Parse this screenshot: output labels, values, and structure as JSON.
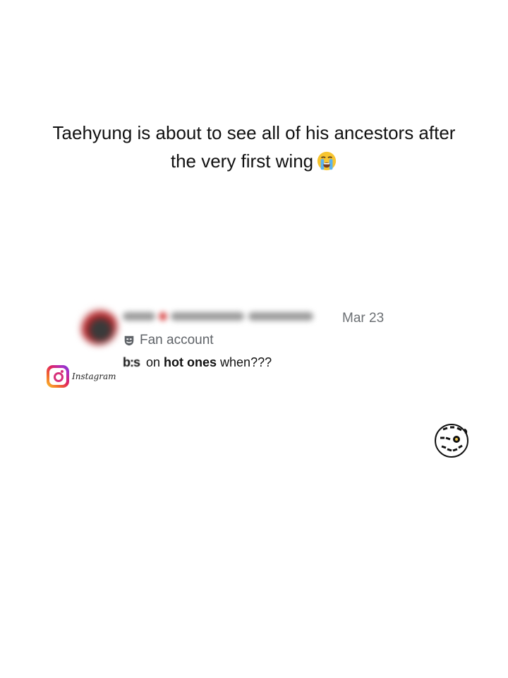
{
  "caption": {
    "line1": "Taehyung is about to see all of his ancestors after",
    "line2": "the very first wing",
    "emoji": "loudly-crying-face-icon"
  },
  "post": {
    "date": "Mar 23",
    "badge_label": "Fan account",
    "badge_icon": "theater-mask-icon",
    "text_glitch": "b:s",
    "text_mid": " on ",
    "text_bold": "hot ones",
    "text_end": " when???"
  },
  "instagram": {
    "label": "Instagram"
  },
  "watermark": {
    "name": "first-we-feast-logo"
  },
  "colors": {
    "background": "#ffffff",
    "caption_text": "#111111",
    "muted_text": "#6b6f73"
  }
}
